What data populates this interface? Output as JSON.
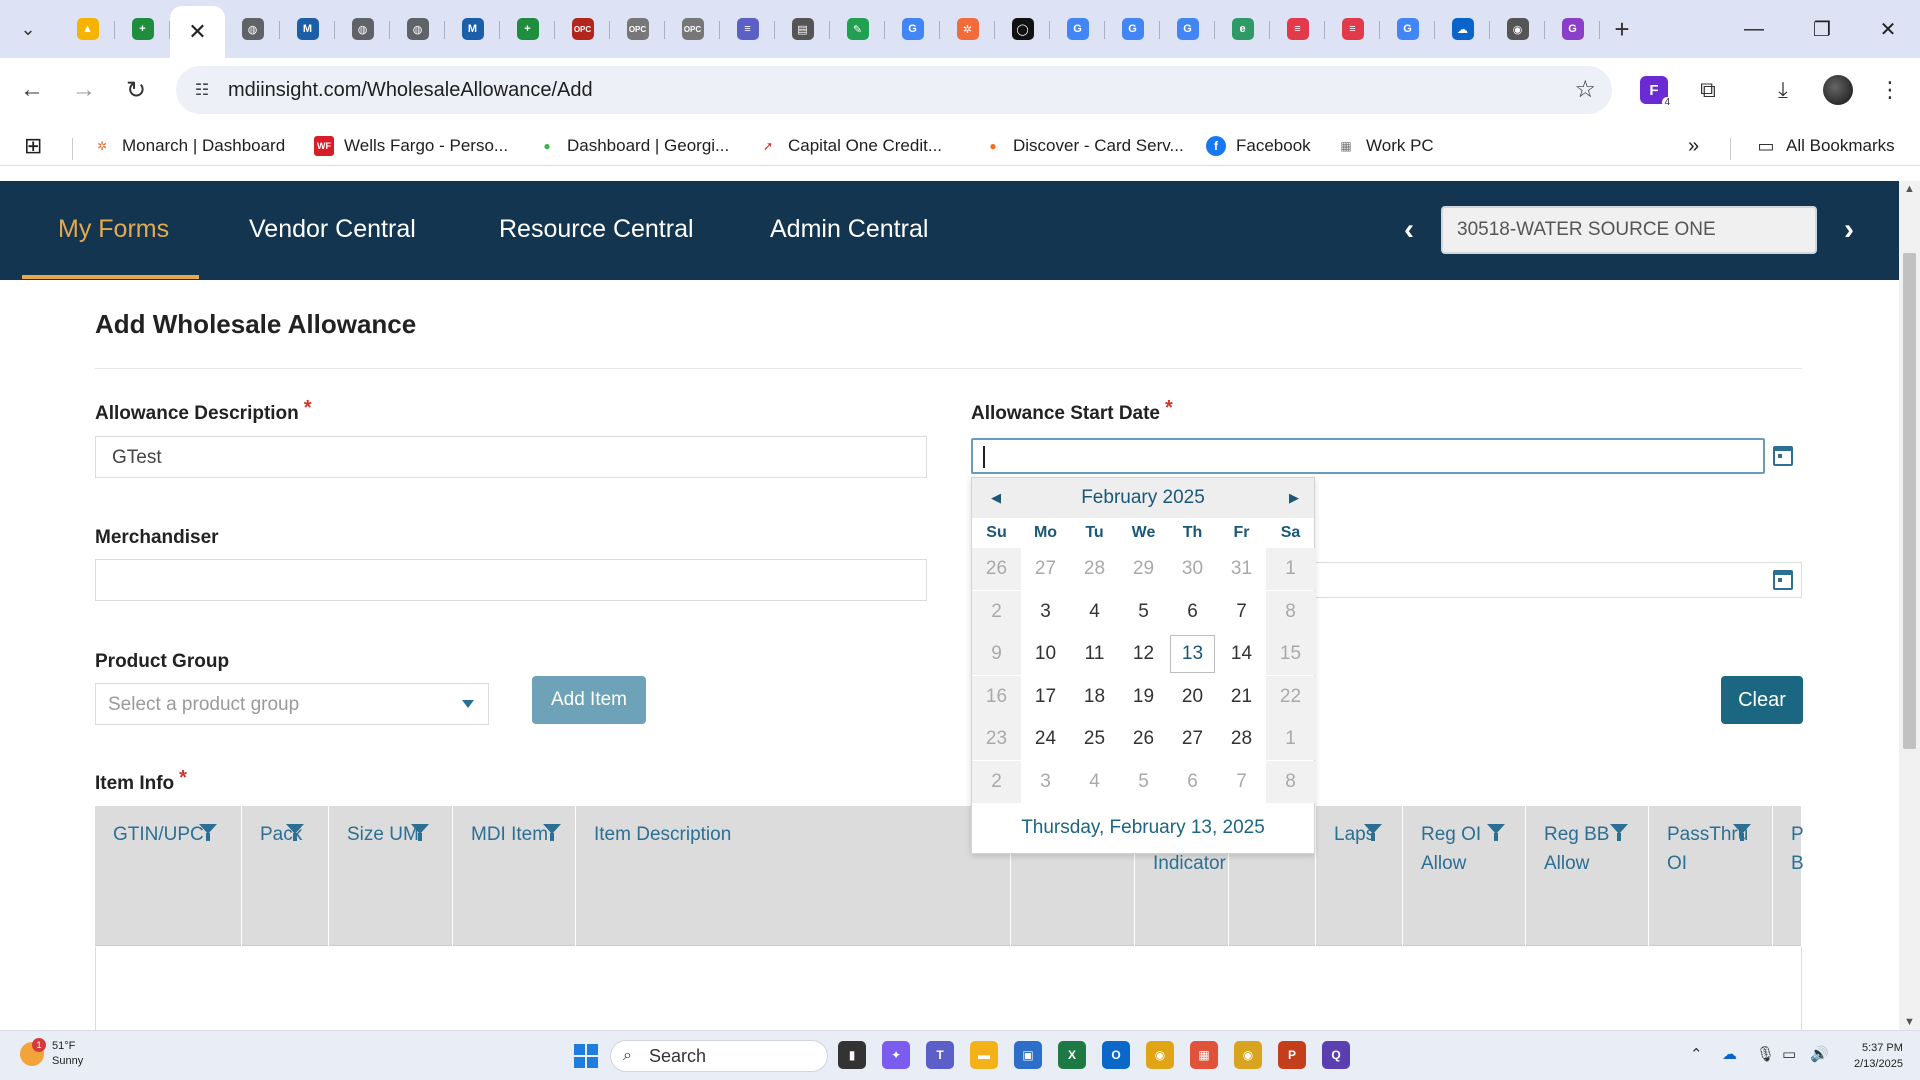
{
  "browser": {
    "tabs": [
      {
        "icon": "google-drive-icon",
        "color": "#f4b400",
        "glyph": "▲"
      },
      {
        "icon": "google-sheets-icon",
        "color": "#1e8e3e",
        "glyph": "+"
      },
      {
        "icon": "active-tab-close-icon",
        "active": true,
        "glyph": "✕"
      },
      {
        "icon": "globe-icon",
        "color": "#5f6368",
        "glyph": "◍"
      },
      {
        "icon": "mdi-logo-icon",
        "color": "#1b5fa8",
        "glyph": "M"
      },
      {
        "icon": "globe-icon",
        "color": "#5f6368",
        "glyph": "◍"
      },
      {
        "icon": "globe-icon",
        "color": "#5f6368",
        "glyph": "◍"
      },
      {
        "icon": "mdi-logo-icon",
        "color": "#1b5fa8",
        "glyph": "M"
      },
      {
        "icon": "google-sheets-icon",
        "color": "#1e8e3e",
        "glyph": "+"
      },
      {
        "icon": "opc-icon",
        "color": "#b3261e",
        "glyph": "OPC"
      },
      {
        "icon": "opc-icon",
        "color": "#777777",
        "glyph": "OPC"
      },
      {
        "icon": "opc-icon",
        "color": "#777777",
        "glyph": "OPC"
      },
      {
        "icon": "book-icon",
        "color": "#5c5fc4",
        "glyph": "≡"
      },
      {
        "icon": "page-icon",
        "color": "#555555",
        "glyph": "▤"
      },
      {
        "icon": "feather-icon",
        "color": "#20a050",
        "glyph": "✎"
      },
      {
        "icon": "google-icon",
        "color": "#4285f4",
        "glyph": "G"
      },
      {
        "icon": "monarch-icon",
        "color": "#f26b3a",
        "glyph": "✲"
      },
      {
        "icon": "circle-logo-icon",
        "color": "#111111",
        "glyph": "◯"
      },
      {
        "icon": "google-icon",
        "color": "#4285f4",
        "glyph": "G"
      },
      {
        "icon": "google-icon",
        "color": "#4285f4",
        "glyph": "G"
      },
      {
        "icon": "google-icon",
        "color": "#4285f4",
        "glyph": "G"
      },
      {
        "icon": "edge-icon",
        "color": "#2f9a68",
        "glyph": "e"
      },
      {
        "icon": "red-chat-icon",
        "color": "#e03a4b",
        "glyph": "≡"
      },
      {
        "icon": "red-chat-icon",
        "color": "#e03a4b",
        "glyph": "≡"
      },
      {
        "icon": "google-icon",
        "color": "#4285f4",
        "glyph": "G"
      },
      {
        "icon": "onedrive-icon",
        "color": "#0a64c9",
        "glyph": "☁"
      },
      {
        "icon": "chrome-icon",
        "color": "#555555",
        "glyph": "◉"
      },
      {
        "icon": "search-g-icon",
        "color": "#8b3fc8",
        "glyph": "G"
      }
    ],
    "url": "mdiinsight.com/WholesaleAllowance/Add",
    "bookmarks": [
      {
        "label": "Monarch | Dashboard",
        "icon": "monarch-icon",
        "color": "#f26b3a",
        "glyph": "✲"
      },
      {
        "label": "Wells Fargo - Perso...",
        "icon": "wells-fargo-icon",
        "color": "#d71e28",
        "glyph": "WF"
      },
      {
        "label": "Dashboard | Georgi...",
        "icon": "georgia-icon",
        "color": "#3bb54a",
        "glyph": "●"
      },
      {
        "label": "Capital One Credit...",
        "icon": "capital-one-icon",
        "color": "#d03027",
        "glyph": "➚"
      },
      {
        "label": "Discover - Card Serv...",
        "icon": "discover-icon",
        "color": "#f26b21",
        "glyph": "●"
      },
      {
        "label": "Facebook",
        "icon": "facebook-icon",
        "color": "#1877f2",
        "glyph": "f"
      },
      {
        "label": "Work PC",
        "icon": "work-pc-icon",
        "color": "#777777",
        "glyph": "▦"
      }
    ],
    "all_bookmarks": "All Bookmarks",
    "extension_badge": "4"
  },
  "appnav": {
    "items": [
      "My Forms",
      "Vendor Central",
      "Resource Central",
      "Admin Central"
    ],
    "vendor": "30518-WATER SOURCE ONE"
  },
  "form": {
    "title": "Add Wholesale Allowance",
    "required_mark": "*",
    "allowance_description_label": "Allowance Description",
    "allowance_description_value": "GTest",
    "merchandiser_label": "Merchandiser",
    "merchandiser_value": "",
    "start_date_label": "Allowance Start Date",
    "start_date_value": "",
    "product_group_label": "Product Group",
    "product_group_placeholder": "Select a product group",
    "add_item_label": "Add Item",
    "clear_label": "Clear",
    "item_info_label": "Item Info"
  },
  "grid": {
    "columns": [
      {
        "label": "GTIN/UPC",
        "filter": true
      },
      {
        "label": "Pack",
        "filter": true
      },
      {
        "label": "Size UM",
        "filter": true
      },
      {
        "label": "MDI Item",
        "filter": true
      },
      {
        "label": "Item Description",
        "filter": false
      },
      {
        "label": "",
        "filter": false
      },
      {
        "label": "Cost Indicator",
        "filter": false
      },
      {
        "label": "",
        "filter": false
      },
      {
        "label": "Laps",
        "filter": true
      },
      {
        "label": "Reg OI Allow",
        "filter": true
      },
      {
        "label": "Reg BB Allow",
        "filter": true
      },
      {
        "label": "PassThru OI",
        "filter": true
      },
      {
        "label": "P B",
        "filter": false
      }
    ]
  },
  "calendar": {
    "month_label": "February 2025",
    "weekdays": [
      "Su",
      "Mo",
      "Tu",
      "We",
      "Th",
      "Fr",
      "Sa"
    ],
    "weeks": [
      [
        "26",
        "27",
        "28",
        "29",
        "30",
        "31",
        "1"
      ],
      [
        "2",
        "3",
        "4",
        "5",
        "6",
        "7",
        "8"
      ],
      [
        "9",
        "10",
        "11",
        "12",
        "13",
        "14",
        "15"
      ],
      [
        "16",
        "17",
        "18",
        "19",
        "20",
        "21",
        "22"
      ],
      [
        "23",
        "24",
        "25",
        "26",
        "27",
        "28",
        "1"
      ],
      [
        "2",
        "3",
        "4",
        "5",
        "6",
        "7",
        "8"
      ]
    ],
    "today": "13",
    "today_label": "Thursday, February 13, 2025"
  },
  "taskbar": {
    "temperature": "51°F",
    "condition": "Sunny",
    "weather_alert_count": "1",
    "search_label": "Search",
    "time": "5:37 PM",
    "date": "2/13/2025"
  }
}
